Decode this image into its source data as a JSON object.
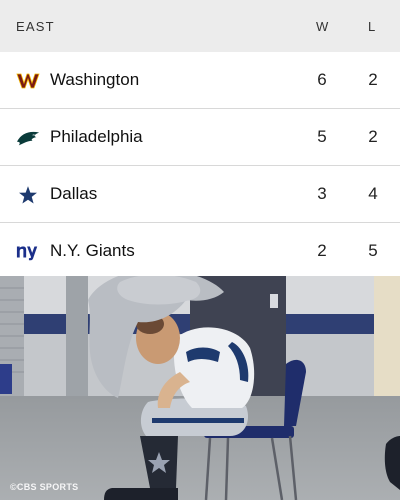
{
  "standings": {
    "conference": "EAST",
    "col_w": "W",
    "col_l": "L",
    "teams": [
      {
        "name": "Washington",
        "w": "6",
        "l": "2",
        "logo": "commanders-logo-icon"
      },
      {
        "name": "Philadelphia",
        "w": "5",
        "l": "2",
        "logo": "eagles-logo-icon"
      },
      {
        "name": "Dallas",
        "w": "3",
        "l": "4",
        "logo": "cowboys-star-icon"
      },
      {
        "name": "N.Y. Giants",
        "w": "2",
        "l": "5",
        "logo": "giants-ny-logo-icon"
      }
    ]
  },
  "photo": {
    "credit": "©CBS SPORTS"
  },
  "colors": {
    "header_bg": "#ececec",
    "commanders": "#7a1a14",
    "eagles": "#0a3b3a",
    "cowboys": "#1e3a6e",
    "giants": "#1b2f8a"
  }
}
